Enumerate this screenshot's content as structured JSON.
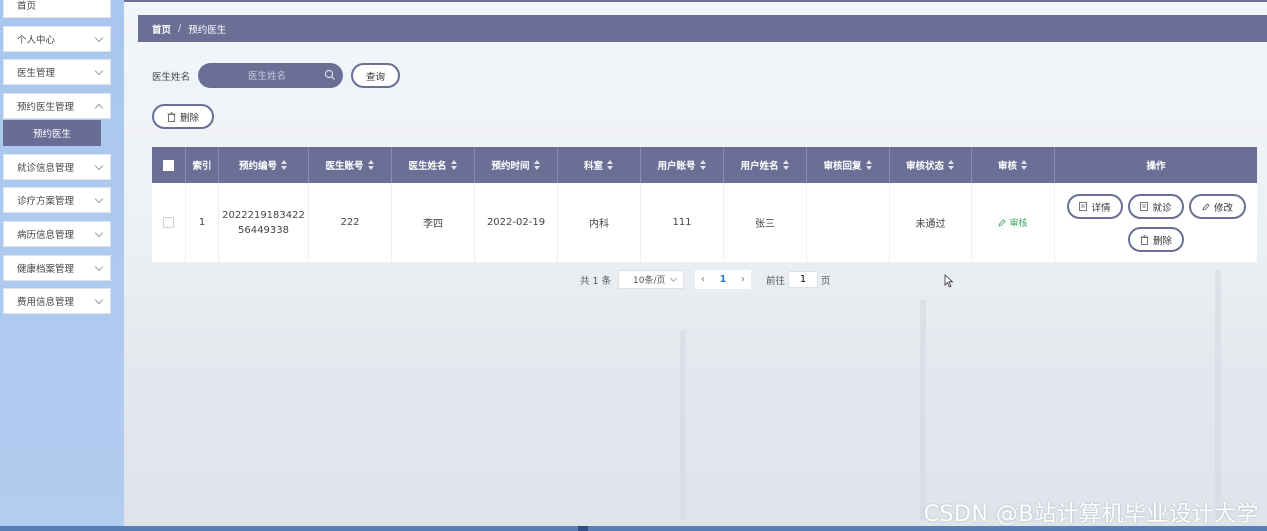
{
  "sidebar": {
    "items": [
      {
        "label": "首页"
      },
      {
        "label": "个人中心"
      },
      {
        "label": "医生管理"
      },
      {
        "label": "预约医生管理"
      },
      {
        "label": "就诊信息管理"
      },
      {
        "label": "诊疗方案管理"
      },
      {
        "label": "病历信息管理"
      },
      {
        "label": "健康档案管理"
      },
      {
        "label": "费用信息管理"
      }
    ],
    "active_sub": "预约医生"
  },
  "breadcrumb": {
    "home": "首页",
    "separator": "/",
    "current": "预约医生"
  },
  "search": {
    "label": "医生姓名",
    "placeholder": "医生姓名",
    "query_label": "查询"
  },
  "toolbar": {
    "delete_label": "删除"
  },
  "table": {
    "headers": [
      "索引",
      "预约编号",
      "医生账号",
      "医生姓名",
      "预约时间",
      "科室",
      "用户账号",
      "用户姓名",
      "审核回复",
      "审核状态",
      "审核",
      "操作"
    ],
    "rows": [
      {
        "index": "1",
        "appointment_no": "2022219183422 56449338",
        "doctor_account": "222",
        "doctor_name": "李四",
        "appointment_time": "2022-02-19",
        "department": "内科",
        "user_account": "111",
        "user_name": "张三",
        "review_reply": "",
        "review_status": "未通过",
        "audit_label": "审核"
      }
    ],
    "row_actions": {
      "detail": "详情",
      "visit": "就诊",
      "edit": "修改",
      "delete": "删除"
    }
  },
  "pagination": {
    "total_text": "共 1 条",
    "page_size": "10条/页",
    "current_page": "1",
    "goto_label": "前往",
    "goto_value": "1",
    "page_suffix": "页"
  },
  "watermark": "CSDN @B站计算机毕业设计大学",
  "colors": {
    "primary": "#6b6f96",
    "sidebar": "#a9c6ee",
    "success": "#3aa85f",
    "pager_active": "#2a7de1"
  }
}
